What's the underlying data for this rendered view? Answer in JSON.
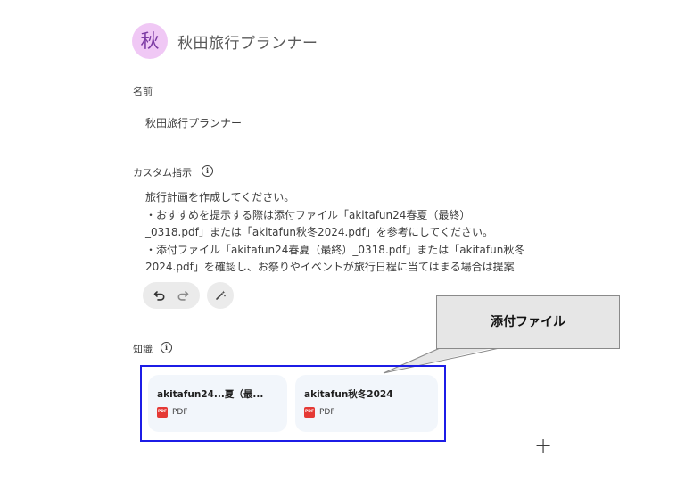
{
  "header": {
    "avatar_char": "秋",
    "title": "秋田旅行プランナー"
  },
  "name_field": {
    "label": "名前",
    "value": "秋田旅行プランナー"
  },
  "instructions_field": {
    "label": "カスタム指示",
    "info_icon": "i",
    "lines": [
      "旅行計画を作成してください。",
      "・おすすめを提示する際は添付ファイル「akitafun24春夏（最終）",
      "_0318.pdf」または「akitafun秋冬2024.pdf」を参考にしてください。",
      "・添付ファイル「akitafun24春夏（最終）_0318.pdf」または「akitafun秋冬",
      "2024.pdf」を確認し、お祭りやイベントが旅行日程に当てはまる場合は提案"
    ]
  },
  "toolbar": {
    "undo_icon": "undo-icon",
    "redo_icon": "redo-icon",
    "magic_icon": "magic-wand-icon"
  },
  "knowledge": {
    "label": "知識",
    "info_icon": "i",
    "files": [
      {
        "name": "akitafun24...夏（最...",
        "type": "PDF",
        "icon_text": "PDF"
      },
      {
        "name": "akitafun秋冬2024",
        "type": "PDF",
        "icon_text": "PDF"
      }
    ],
    "add_label": "+"
  },
  "callout": {
    "text": "添付ファイル"
  },
  "colors": {
    "avatar_bg": "#f0c8f5",
    "highlight_border": "#1c1ce6",
    "pdf_red": "#e53935"
  }
}
